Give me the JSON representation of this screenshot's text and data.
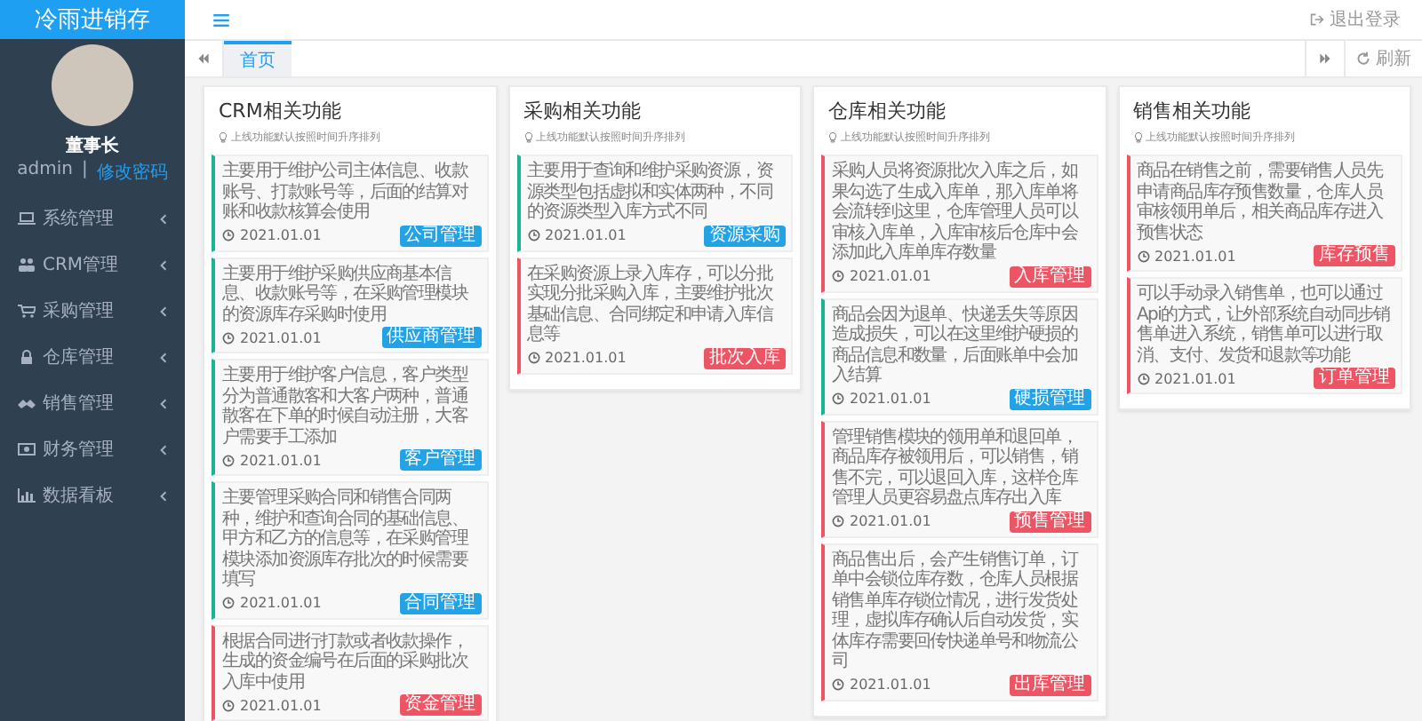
{
  "sidebar": {
    "logo": "冷雨进销存",
    "user": {
      "name": "董事长",
      "account": "admin",
      "separator": "|",
      "change_password": "修改密码"
    },
    "menu": [
      {
        "label": "系统管理"
      },
      {
        "label": "CRM管理"
      },
      {
        "label": "采购管理"
      },
      {
        "label": "仓库管理"
      },
      {
        "label": "销售管理"
      },
      {
        "label": "财务管理"
      },
      {
        "label": "数据看板"
      }
    ]
  },
  "header": {
    "logout": "退出登录"
  },
  "tabs": [
    {
      "label": "首页",
      "selected": true
    }
  ],
  "refresh": "刷新",
  "panels": [
    {
      "title": "CRM相关功能",
      "subtitle": "上线功能默认按照时间升序排列",
      "items": [
        {
          "text": "主要用于维护公司主体信息、收款账号、打款账号等，后面的结算对账和收款核算会使用",
          "date": "2021.01.01",
          "tag": "公司管理",
          "kind": "info"
        },
        {
          "text": "主要用于维护采购供应商基本信息、收款账号等，在采购管理模块的资源库存采购时使用",
          "date": "2021.01.01",
          "tag": "供应商管理",
          "kind": "info"
        },
        {
          "text": "主要用于维护客户信息，客户类型分为普通散客和大客户两种，普通散客在下单的时候自动注册，大客户需要手工添加",
          "date": "2021.01.01",
          "tag": "客户管理",
          "kind": "info"
        },
        {
          "text": "主要管理采购合同和销售合同两种，维护和查询合同的基础信息、甲方和乙方的信息等，在采购管理模块添加资源库存批次的时候需要填写",
          "date": "2021.01.01",
          "tag": "合同管理",
          "kind": "info"
        },
        {
          "text": "根据合同进行打款或者收款操作，生成的资金编号在后面的采购批次入库中使用",
          "date": "2021.01.01",
          "tag": "资金管理",
          "kind": "alert"
        }
      ]
    },
    {
      "title": "采购相关功能",
      "subtitle": "上线功能默认按照时间升序排列",
      "items": [
        {
          "text": "主要用于查询和维护采购资源，资源类型包括虚拟和实体两种，不同的资源类型入库方式不同",
          "date": "2021.01.01",
          "tag": "资源采购",
          "kind": "info"
        },
        {
          "text": "在采购资源上录入库存，可以分批实现分批采购入库，主要维护批次基础信息、合同绑定和申请入库信息等",
          "date": "2021.01.01",
          "tag": "批次入库",
          "kind": "alert"
        }
      ]
    },
    {
      "title": "仓库相关功能",
      "subtitle": "上线功能默认按照时间升序排列",
      "items": [
        {
          "text": "采购人员将资源批次入库之后，如果勾选了生成入库单，那入库单将会流转到这里，仓库管理人员可以审核入库单，入库审核后仓库中会添加此入库单库存数量",
          "date": "2021.01.01",
          "tag": "入库管理",
          "kind": "alert"
        },
        {
          "text": "商品会因为退单、快递丢失等原因造成损失，可以在这里维护硬损的商品信息和数量，后面账单中会加入结算",
          "date": "2021.01.01",
          "tag": "硬损管理",
          "kind": "info"
        },
        {
          "text": "管理销售模块的领用单和退回单，商品库存被领用后，可以销售，销售不完，可以退回入库，这样仓库管理人员更容易盘点库存出入库",
          "date": "2021.01.01",
          "tag": "预售管理",
          "kind": "alert"
        },
        {
          "text": "商品售出后，会产生销售订单，订单中会锁位库存数，仓库人员根据销售单库存锁位情况，进行发货处理，虚拟库存确认后自动发货，实体库存需要回传快递单号和物流公司",
          "date": "2021.01.01",
          "tag": "出库管理",
          "kind": "alert"
        }
      ]
    },
    {
      "title": "销售相关功能",
      "subtitle": "上线功能默认按照时间升序排列",
      "items": [
        {
          "text": "商品在销售之前，需要销售人员先申请商品库存预售数量，仓库人员审核领用单后，相关商品库存进入预售状态",
          "date": "2021.01.01",
          "tag": "库存预售",
          "kind": "alert"
        },
        {
          "text": "可以手动录入销售单，也可以通过Api的方式，让外部系统自动同步销售单进入系统，销售单可以进行取消、支付、发货和退款等功能",
          "date": "2021.01.01",
          "tag": "订单管理",
          "kind": "alert"
        }
      ]
    }
  ]
}
